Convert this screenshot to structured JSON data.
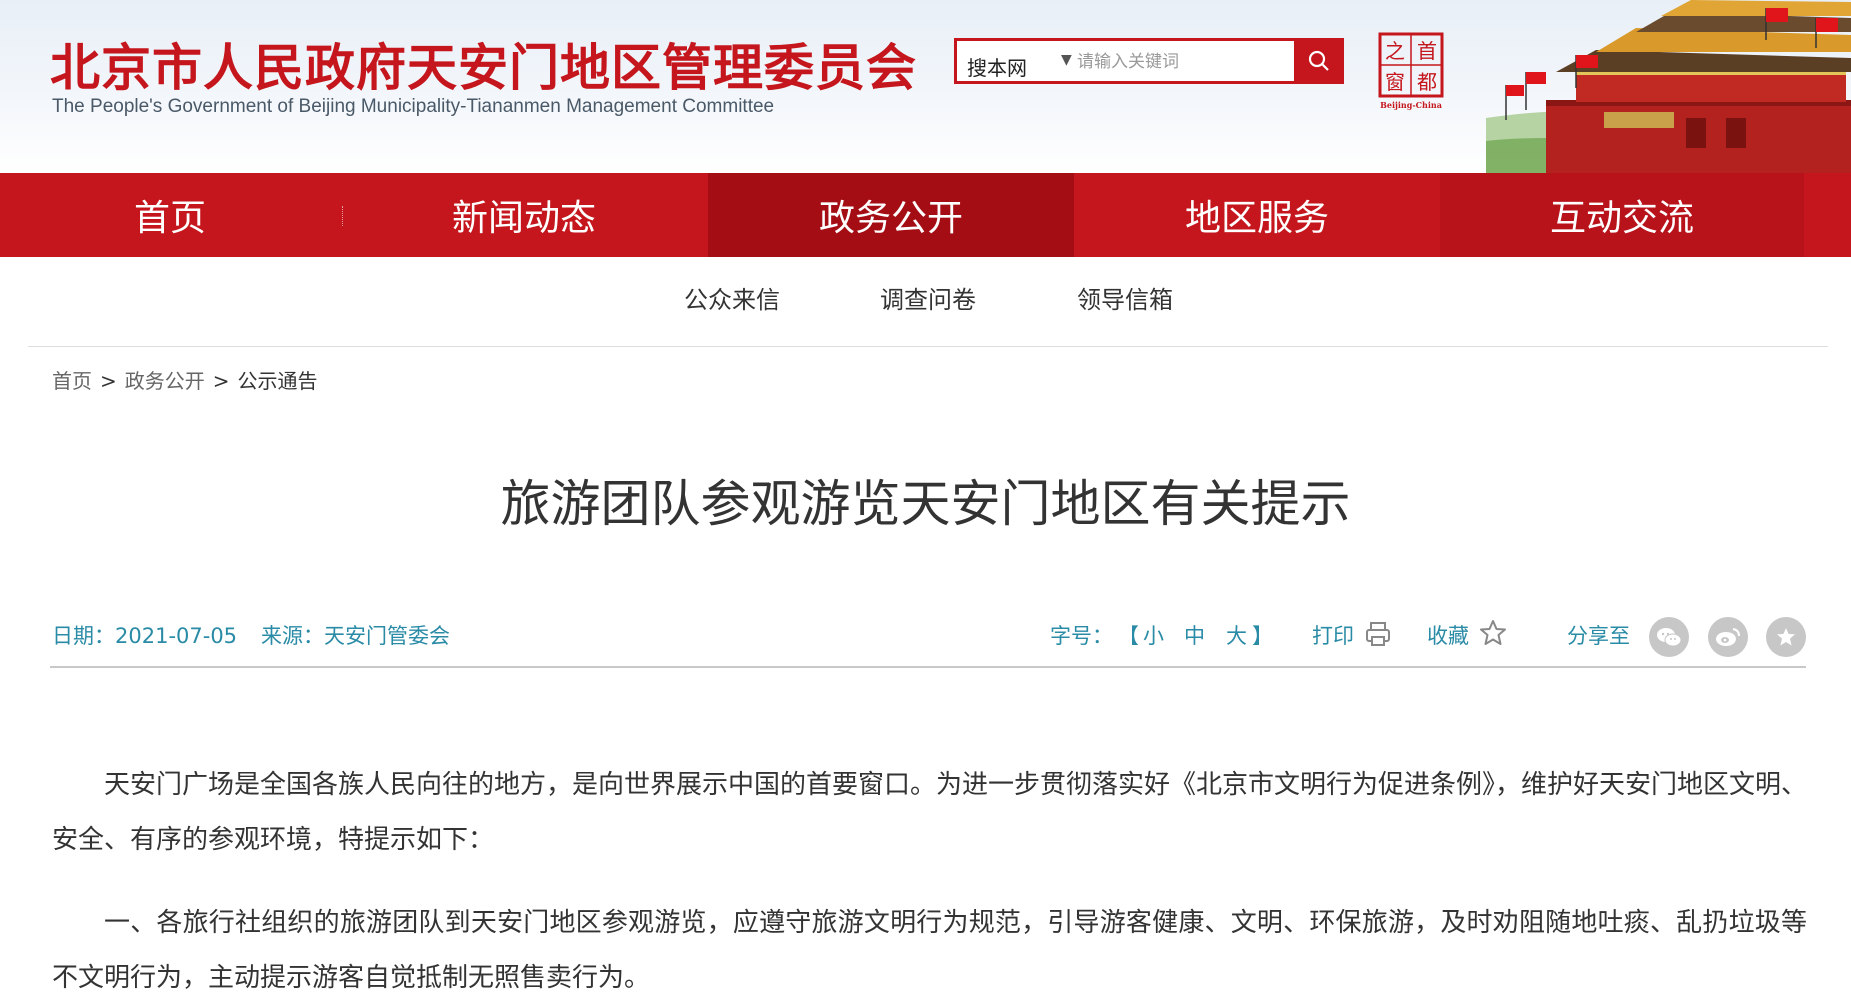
{
  "header": {
    "title": "北京市人民政府天安门地区管理委员会",
    "subtitle": "The People's Government of Beijing Municipality-Tiananmen Management Committee",
    "search": {
      "scope": "搜本网",
      "placeholder": "请输入关键词"
    },
    "seal": {
      "chars": [
        "之",
        "首",
        "窗",
        "都"
      ],
      "caption": "Beijing-China"
    }
  },
  "nav": {
    "items": [
      {
        "label": "首页"
      },
      {
        "label": "新闻动态"
      },
      {
        "label": "政务公开",
        "active": true
      },
      {
        "label": "地区服务"
      },
      {
        "label": "互动交流"
      }
    ],
    "subitems": [
      {
        "label": "公众来信"
      },
      {
        "label": "调查问卷"
      },
      {
        "label": "领导信箱"
      }
    ]
  },
  "breadcrumb": {
    "items": [
      "首页",
      "政务公开",
      "公示通告"
    ],
    "separator": ">"
  },
  "article": {
    "title": "旅游团队参观游览天安门地区有关提示",
    "date": "日期：2021-07-05",
    "source": "来源：天安门管委会",
    "font_size_label": "字号：",
    "bracket_open": "【",
    "bracket_close": "】",
    "font_sizes": [
      "小",
      "中",
      "大"
    ],
    "print_label": "打印",
    "favorite_label": "收藏",
    "share_label": "分享至",
    "share_targets": [
      "wechat-icon",
      "weibo-icon",
      "star-icon"
    ],
    "paragraphs": [
      "天安门广场是全国各族人民向往的地方，是向世界展示中国的首要窗口。为进一步贯彻落实好《北京市文明行为促进条例》，维护好天安门地区文明、安全、有序的参观环境，特提示如下：",
      "一、各旅行社组织的旅游团队到天安门地区参观游览，应遵守旅游文明行为规范，引导游客健康、文明、环保旅游，及时劝阻随地吐痰、乱扔垃圾等不文明行为，主动提示游客自觉抵制无照售卖行为。"
    ]
  },
  "colors": {
    "brand_red": "#c4161c",
    "nav_active": "#a50d14",
    "link_teal": "#2a8ba6"
  }
}
